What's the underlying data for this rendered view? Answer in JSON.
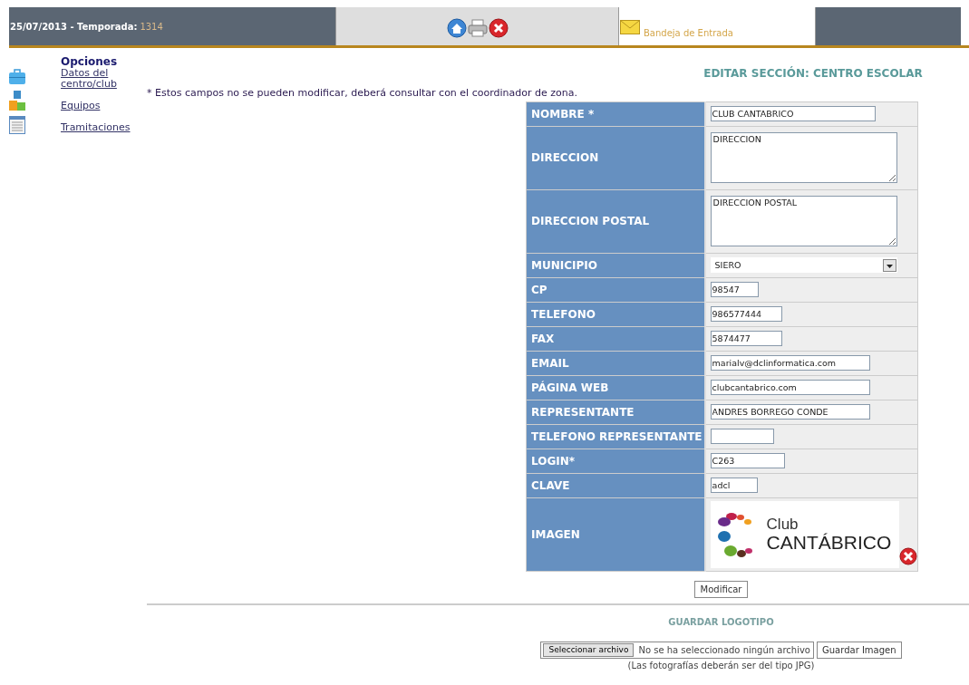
{
  "header": {
    "date": "25/07/2013 - Temporada:",
    "season": "1314",
    "inbox": "Bandeja de Entrada"
  },
  "sidebar": {
    "title": "Opciones",
    "items": [
      {
        "label": "Datos del centro/club"
      },
      {
        "label": "Equipos"
      },
      {
        "label": "Tramitaciones"
      }
    ]
  },
  "notice": "* Estos campos no se pueden modificar, deberá consultar con el coordinador de zona.",
  "form": {
    "title": "EDITAR SECCIÓN: CENTRO ESCOLAR",
    "rows": [
      {
        "label": "NOMBRE *",
        "kind": "text",
        "value": "CLUB CANTABRICO"
      },
      {
        "label": "DIRECCION",
        "kind": "textarea",
        "value": "DIRECCION"
      },
      {
        "label": "DIRECCION POSTAL",
        "kind": "textarea",
        "value": "DIRECCION POSTAL"
      },
      {
        "label": "MUNICIPIO",
        "kind": "select",
        "value": "SIERO"
      },
      {
        "label": "CP",
        "kind": "text",
        "value": "98547"
      },
      {
        "label": "TELEFONO",
        "kind": "text",
        "value": "986577444"
      },
      {
        "label": "FAX",
        "kind": "text",
        "value": "5874477"
      },
      {
        "label": "EMAIL",
        "kind": "text",
        "value": "marialv@dclinformatica.com"
      },
      {
        "label": "PÁGINA WEB",
        "kind": "text",
        "value": "clubcantabrico.com"
      },
      {
        "label": "REPRESENTANTE",
        "kind": "text",
        "value": "ANDRES BORREGO CONDE"
      },
      {
        "label": "TELEFONO REPRESENTANTE",
        "kind": "text"
      },
      {
        "label": "LOGIN*",
        "kind": "text",
        "value": "C263"
      },
      {
        "label": "CLAVE",
        "kind": "text",
        "value": "adcl"
      },
      {
        "label": "IMAGEN",
        "kind": "image",
        "logo_line_1": "Club",
        "logo_line_2": "CANTÁBRICO"
      }
    ],
    "submit": "Modificar"
  },
  "logo_upload": {
    "title": "GUARDAR LOGOTIPO",
    "choose_button": "Seleccionar archivo",
    "file_status": "No se ha seleccionado ningún archivo",
    "save_button": "Guardar Imagen",
    "note": "(Las fotografías deberán ser del tipo JPG)"
  }
}
